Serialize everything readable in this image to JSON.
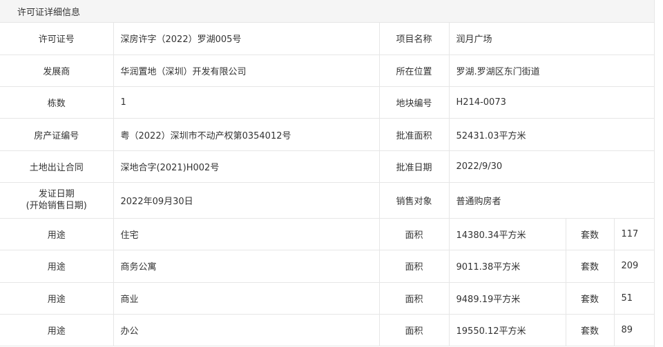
{
  "header": {
    "title": "许可证详细信息"
  },
  "rows": [
    {
      "l1": "许可证号",
      "v1": "深房许字（2022）罗湖005号",
      "l2": "项目名称",
      "v2": "润月广场"
    },
    {
      "l1": "发展商",
      "v1": "华润置地（深圳）开发有限公司",
      "l2": "所在位置",
      "v2": "罗湖.罗湖区东门街道"
    },
    {
      "l1": "栋数",
      "v1": "1",
      "l2": "地块编号",
      "v2": "H214-0073"
    },
    {
      "l1": "房产证编号",
      "v1": "粤（2022）深圳市不动产权第0354012号",
      "l2": "批准面积",
      "v2": "52431.03平方米"
    },
    {
      "l1": "土地出让合同",
      "v1": "深地合字(2021)H002号",
      "l2": "批准日期",
      "v2": "2022/9/30"
    },
    {
      "l1a": "发证日期",
      "l1b": "(开始销售日期)",
      "v1": "2022年09月30日",
      "l2": "销售对象",
      "v2": "普通购房者"
    }
  ],
  "usage_rows": [
    {
      "label": "用途",
      "type": "住宅",
      "area_label": "面积",
      "area": "14380.34平方米",
      "count_label": "套数",
      "count": "117"
    },
    {
      "label": "用途",
      "type": "商务公寓",
      "area_label": "面积",
      "area": "9011.38平方米",
      "count_label": "套数",
      "count": "209"
    },
    {
      "label": "用途",
      "type": "商业",
      "area_label": "面积",
      "area": "9489.19平方米",
      "count_label": "套数",
      "count": "51"
    },
    {
      "label": "用途",
      "type": "办公",
      "area_label": "面积",
      "area": "19550.12平方米",
      "count_label": "套数",
      "count": "89"
    }
  ]
}
